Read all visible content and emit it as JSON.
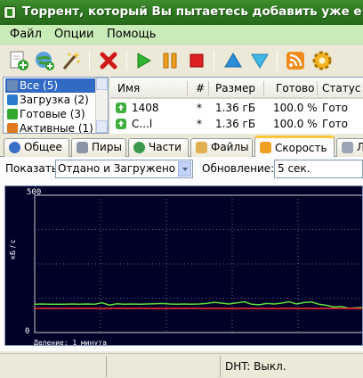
{
  "window": {
    "title": "Торрент, который Вы пытаетесь добавить уже е"
  },
  "menu": {
    "items": [
      "Файл",
      "Опции",
      "Помощь"
    ]
  },
  "toolbar": {
    "buttons": [
      "add-torrent-icon",
      "add-url-icon",
      "create-torrent-icon",
      "remove-icon",
      "start-icon",
      "pause-icon",
      "stop-icon",
      "move-up-icon",
      "move-down-icon",
      "rss-icon",
      "settings-icon"
    ]
  },
  "categories": [
    {
      "label": "Все (5)",
      "selected": true
    },
    {
      "label": "Загрузка (2)",
      "selected": false
    },
    {
      "label": "Готовые (3)",
      "selected": false
    },
    {
      "label": "Активные (1)",
      "selected": false
    }
  ],
  "table": {
    "columns": [
      "Имя",
      "#",
      "Размер",
      "Готово",
      "Статус"
    ],
    "rows": [
      {
        "name": "1408",
        "num": "*",
        "size": "1.36 гБ",
        "done": "100.0 %",
        "status": "Гото"
      },
      {
        "name": "C...l",
        "num": "*",
        "size": "1.36 гБ",
        "done": "100.0 %",
        "status": "Гото"
      }
    ]
  },
  "tabs": [
    {
      "label": "Общее",
      "icon": "info-icon",
      "active": false
    },
    {
      "label": "Пиры",
      "icon": "peers-icon",
      "active": false
    },
    {
      "label": "Части",
      "icon": "pieces-icon",
      "active": false
    },
    {
      "label": "Файлы",
      "icon": "files-icon",
      "active": false
    },
    {
      "label": "Скорость",
      "icon": "speed-icon",
      "active": true
    },
    {
      "label": "Л",
      "icon": "log-icon",
      "active": false
    }
  ],
  "speed": {
    "show_label": "Показать",
    "show_value": "Отдано и Загружено",
    "update_label": "Обновление:",
    "update_value": "5 сек."
  },
  "chart_data": {
    "type": "line",
    "ylabel": "кБ / с",
    "ylim": [
      0,
      500
    ],
    "yticks": [
      "500",
      "0"
    ],
    "footer": "Деление: 1 минута",
    "grid": true,
    "series": [
      {
        "color": "#5be03a",
        "values": [
          103,
          104,
          103,
          103,
          103,
          104,
          103,
          104,
          103,
          108,
          100,
          105,
          103,
          104,
          103,
          104,
          105,
          106,
          104,
          103,
          104,
          103,
          104,
          106,
          110,
          107,
          104,
          108,
          112,
          103,
          101,
          106,
          104,
          107,
          112,
          104,
          109,
          111,
          103,
          99,
          93,
          95,
          88,
          90,
          92
        ]
      },
      {
        "color": "#ff3030",
        "values": [
          88,
          88,
          88,
          88,
          88,
          88,
          88,
          88,
          88,
          88,
          88,
          88,
          88,
          88,
          88,
          88,
          88,
          88,
          88,
          88,
          88,
          88,
          88,
          88,
          88,
          88,
          88,
          88,
          88,
          88,
          88,
          88,
          88,
          88,
          88,
          88,
          88,
          88,
          88,
          88,
          88,
          88,
          88,
          88,
          88
        ]
      }
    ]
  },
  "statusbar": {
    "dht": "DHT: Выкл."
  }
}
